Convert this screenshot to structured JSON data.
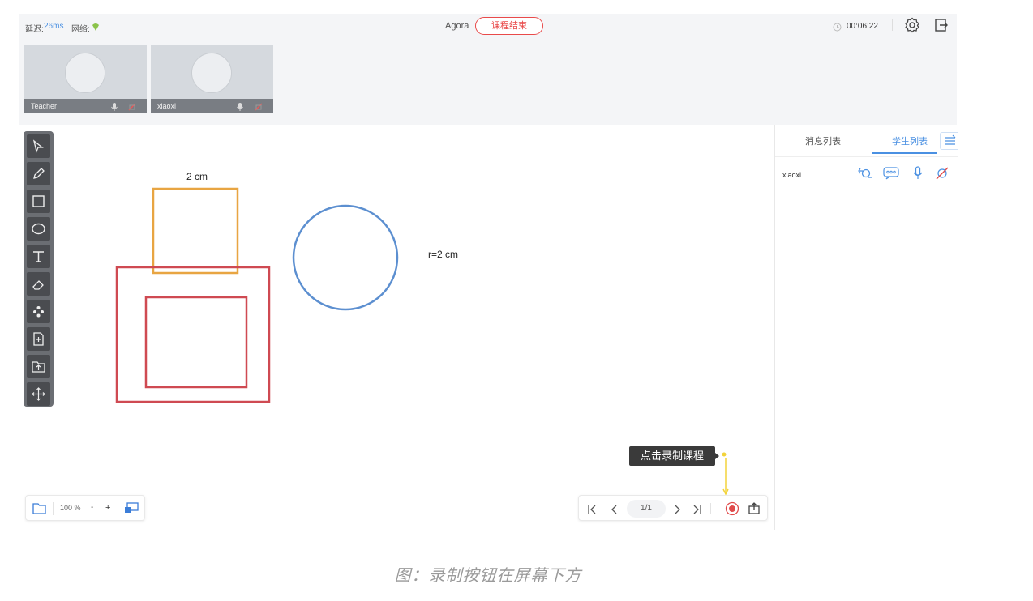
{
  "topbar": {
    "delay_label": "延迟:",
    "delay_value": "26ms",
    "network_label": "网络:",
    "app_name": "Agora",
    "end_class_button": "课程结束",
    "timer": "00:06:22",
    "accent_color": "#4a90e2",
    "end_button_color": "#e94a4a"
  },
  "videos": [
    {
      "name": "Teacher"
    },
    {
      "name": "xiaoxi"
    }
  ],
  "canvas": {
    "label_square": "2 cm",
    "label_circle": "r=2 cm"
  },
  "sidepanel": {
    "tab_messages": "消息列表",
    "tab_students": "学生列表",
    "students": [
      {
        "name": "xiaoxi"
      }
    ]
  },
  "zoom": {
    "value": "100 %",
    "minus": "-",
    "plus": "+"
  },
  "pager": {
    "page": "1/1"
  },
  "tooltip": "点击录制课程",
  "caption": "图：录制按钮在屏幕下方"
}
